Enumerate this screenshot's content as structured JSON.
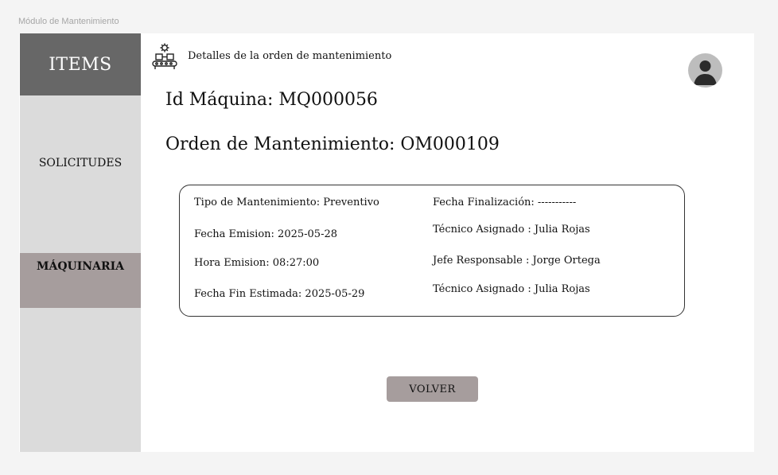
{
  "frame_label": "Módulo de Mantenimiento",
  "sidebar": {
    "items_label": "ITEMS",
    "solicitudes_label": "SOLICITUDES",
    "maquinaria_label": "MÁQUINARIA"
  },
  "header": {
    "icon": "maintenance-gear-icon",
    "title": "Detalles de la orden de mantenimiento",
    "avatar_icon": "user-avatar-icon"
  },
  "main": {
    "id_maquina": "Id Máquina: MQ000056",
    "orden": "Orden de Mantenimiento: OM000109"
  },
  "details": {
    "tipo": "Tipo de Mantenimiento: Preventivo",
    "fecha_emision": "Fecha Emision: 2025-05-28",
    "hora_emision": "Hora Emision: 08:27:00",
    "fecha_fin_estimada": "Fecha Fin Estimada: 2025-05-29",
    "fecha_finalizacion": "Fecha Finalización: -----------",
    "tecnico_asignado_1": "Técnico Asignado : Julia Rojas",
    "jefe_responsable": "Jefe Responsable : Jorge Ortega",
    "tecnico_asignado_2": "Técnico Asignado : Julia Rojas"
  },
  "actions": {
    "volver_label": "VOLVER"
  },
  "colors": {
    "sidebar_bg": "#dbdbdb",
    "sidebar_header_bg": "#676767",
    "active_item_bg": "#a69d9d",
    "button_bg": "#a69d9d"
  }
}
